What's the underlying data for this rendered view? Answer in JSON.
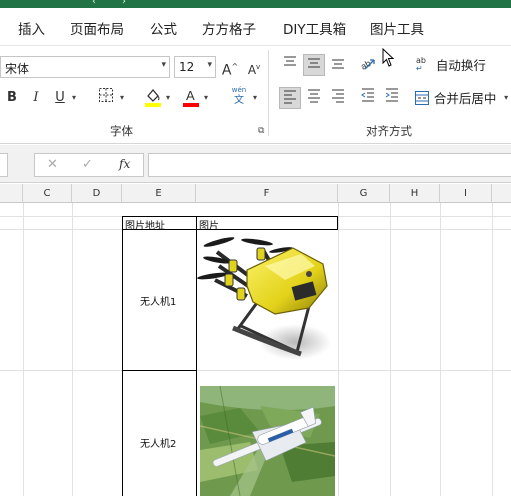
{
  "ribbon_tabs": [
    "插入",
    "页面布局",
    "公式",
    "方方格子",
    "DIY工具箱",
    "图片工具"
  ],
  "font": {
    "name": "宋体",
    "size": "12",
    "grow_label": "A",
    "shrink_label": "A",
    "bold": "B",
    "italic": "I",
    "underline": "U",
    "phonetic_top": "wén",
    "phonetic_bottom": "文",
    "group_label": "字体",
    "highlight_color": "#FFFF00",
    "font_color": "#FF0000"
  },
  "alignment": {
    "wrap_text": "自动换行",
    "merge_center": "合并后居中",
    "group_label": "对齐方式",
    "wrap_icon_text": "ab"
  },
  "formula_bar": {
    "cancel": "✕",
    "confirm": "✓",
    "fx": "fx",
    "value": ""
  },
  "columns": [
    "C",
    "D",
    "E",
    "F",
    "G",
    "H",
    "I"
  ],
  "table": {
    "header_e": "图片地址",
    "header_f": "图片",
    "rows": [
      {
        "label": "无人机1",
        "image": "yellow-quadcopter-drone"
      },
      {
        "label": "无人机2",
        "image": "fixed-wing-drone-over-fields"
      }
    ]
  },
  "colors": {
    "brand_green": "#217346",
    "ribbon_bg": "#ffffff",
    "formula_bg": "#f1f1f1",
    "header_bg": "#f2f2f2"
  }
}
